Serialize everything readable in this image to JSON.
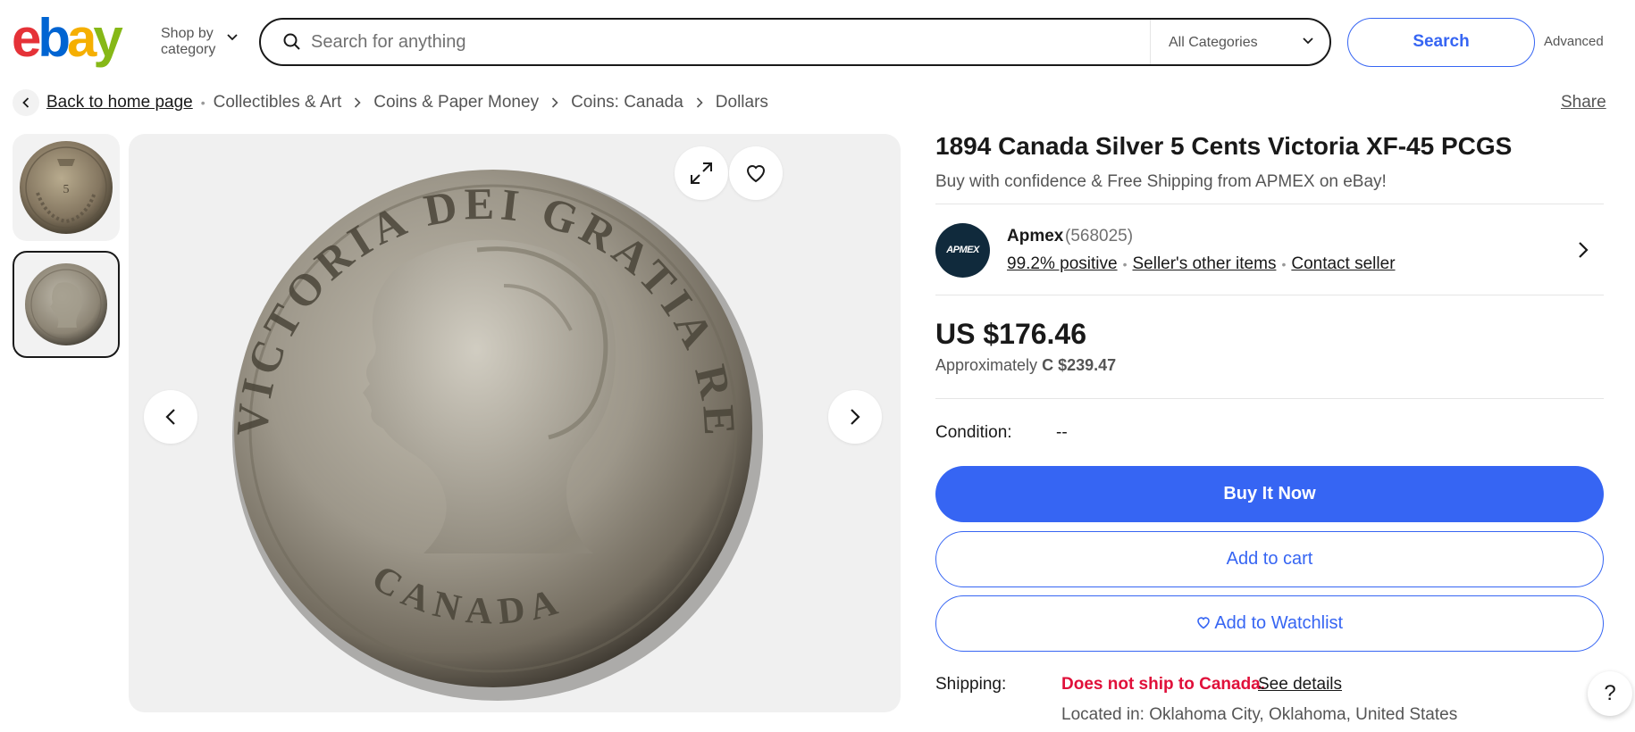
{
  "header": {
    "logo": [
      "e",
      "b",
      "a",
      "y"
    ],
    "shop_by": "Shop by category",
    "search_placeholder": "Search for anything",
    "category_selected": "All Categories",
    "search_button": "Search",
    "advanced": "Advanced"
  },
  "breadcrumb": {
    "back": "Back to home page",
    "items": [
      "Collectibles & Art",
      "Coins & Paper Money",
      "Coins: Canada",
      "Dollars"
    ],
    "share": "Share"
  },
  "gallery": {
    "thumbnail_count": 2,
    "selected_index": 1,
    "coin_legend_top": "VICTORIA DEI GRATIA REGINA",
    "coin_legend_bottom": "CANADA"
  },
  "listing": {
    "title": "1894 Canada Silver 5 Cents Victoria XF-45 PCGS",
    "subtitle": "Buy with confidence & Free Shipping from APMEX on eBay!"
  },
  "seller": {
    "logo_text": "APMEX",
    "name": "Apmex",
    "feedback_count": "(568025)",
    "positive": "99.2% positive",
    "other_items": "Seller's other items",
    "contact": "Contact seller"
  },
  "price": {
    "main": "US $176.46",
    "approx_label": "Approximately",
    "approx_value": "C $239.47"
  },
  "condition": {
    "label": "Condition:",
    "value": "--"
  },
  "actions": {
    "buy_now": "Buy It Now",
    "add_to_cart": "Add to cart",
    "add_to_watchlist": "Add to Watchlist"
  },
  "shipping": {
    "label": "Shipping:",
    "warning": "Does not ship to Canada.",
    "see_details": "See details",
    "located_in": "Located in: Oklahoma City, Oklahoma, United States"
  },
  "help": "?",
  "colors": {
    "accent": "#3665f3",
    "warning": "#e0103a",
    "text": "#191919",
    "muted": "#555555"
  }
}
